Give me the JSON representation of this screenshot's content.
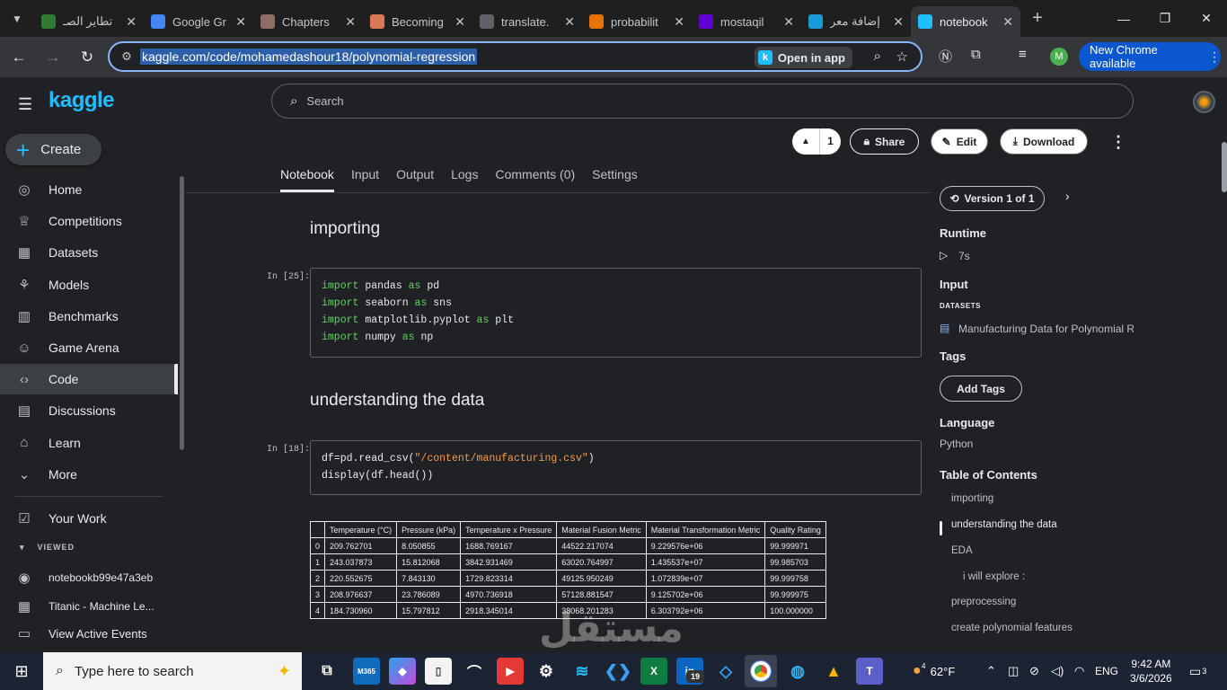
{
  "browser": {
    "tabs": [
      {
        "label": "تطاير الصـ",
        "icon": "globe-green-icon",
        "color": "#2e7d32"
      },
      {
        "label": "Google Gr",
        "icon": "gemini-icon",
        "color": "#4285f4"
      },
      {
        "label": "Chapters",
        "icon": "chapters-icon",
        "color": "#8d6e63"
      },
      {
        "label": "Becoming",
        "icon": "claude-icon",
        "color": "#d97757"
      },
      {
        "label": "translate.",
        "icon": "globe-icon",
        "color": "#5f6368"
      },
      {
        "label": "probabilit",
        "icon": "sheet-icon",
        "color": "#e8710a"
      },
      {
        "label": "mostaqil",
        "icon": "yahoo-icon",
        "color": "#6001d2"
      },
      {
        "label": "إضافة معر",
        "icon": "mostaql-icon",
        "color": "#1d9bd8"
      },
      {
        "label": "notebook",
        "icon": "kaggle-icon",
        "color": "#20beff"
      }
    ],
    "url": "kaggle.com/code/mohamedashour18/polynomial-regression",
    "open_in_app": "Open in app",
    "profile_initial": "M",
    "new_chrome": "New Chrome available"
  },
  "kaggle": {
    "logo": "kaggle",
    "create": "Create",
    "nav": [
      {
        "label": "Home",
        "icon": "compass-icon"
      },
      {
        "label": "Competitions",
        "icon": "trophy-icon"
      },
      {
        "label": "Datasets",
        "icon": "table-icon"
      },
      {
        "label": "Models",
        "icon": "models-icon"
      },
      {
        "label": "Benchmarks",
        "icon": "chart-icon"
      },
      {
        "label": "Game Arena",
        "icon": "robot-icon"
      },
      {
        "label": "Code",
        "icon": "code-icon"
      },
      {
        "label": "Discussions",
        "icon": "discussion-icon"
      },
      {
        "label": "Learn",
        "icon": "learn-icon"
      },
      {
        "label": "More",
        "icon": "chevron-down-icon"
      }
    ],
    "your_work": "Your Work",
    "viewed_label": "VIEWED",
    "viewed": [
      {
        "label": "notebookb99e47a3eb"
      },
      {
        "label": "Titanic - Machine Le..."
      },
      {
        "label": "View Active Events"
      }
    ],
    "search_placeholder": "Search",
    "vote_count": "1",
    "actions": {
      "share": "Share",
      "edit": "Edit",
      "download": "Download"
    },
    "tabs": [
      "Notebook",
      "Input",
      "Output",
      "Logs",
      "Comments (0)",
      "Settings"
    ]
  },
  "notebook": {
    "h_importing": "importing",
    "h_understanding": "understanding the data",
    "cell1_prompt": "In [25]:",
    "cell2_prompt": "In [18]:",
    "imports": [
      {
        "kw": "import",
        "mod": " pandas ",
        "as": "as",
        "alias": " pd"
      },
      {
        "kw": "import",
        "mod": " seaborn ",
        "as": "as",
        "alias": " sns"
      },
      {
        "kw": "import",
        "mod": " matplotlib.pyplot ",
        "as": "as",
        "alias": " plt"
      },
      {
        "kw": "import",
        "mod": " numpy ",
        "as": "as",
        "alias": " np"
      }
    ],
    "read_pre": "df=pd.read_csv(",
    "read_str": "\"/content/manufacturing.csv\"",
    "read_post": ")",
    "display_line": "display(df.head())",
    "table_headers": [
      "",
      "Temperature (°C)",
      "Pressure (kPa)",
      "Temperature x Pressure",
      "Material Fusion Metric",
      "Material Transformation Metric",
      "Quality Rating"
    ],
    "table_rows": [
      [
        "0",
        "209.762701",
        "8.050855",
        "1688.769167",
        "44522.217074",
        "9.229576e+06",
        "99.999971"
      ],
      [
        "1",
        "243.037873",
        "15.812068",
        "3842.931469",
        "63020.764997",
        "1.435537e+07",
        "99.985703"
      ],
      [
        "2",
        "220.552675",
        "7.843130",
        "1729.823314",
        "49125.950249",
        "1.072839e+07",
        "99.999758"
      ],
      [
        "3",
        "208.976637",
        "23.786089",
        "4970.736918",
        "57128.881547",
        "9.125702e+06",
        "99.999975"
      ],
      [
        "4",
        "184.730960",
        "15.797812",
        "2918.345014",
        "38068.201283",
        "6.303792e+06",
        "100.000000"
      ]
    ]
  },
  "panel": {
    "version": "Version 1 of 1",
    "runtime_label": "Runtime",
    "runtime_value": "7s",
    "input_label": "Input",
    "datasets_label": "DATASETS",
    "dataset": "Manufacturing Data for Polynomial Re",
    "tags_label": "Tags",
    "add_tags": "Add Tags",
    "language_label": "Language",
    "language_value": "Python",
    "toc_label": "Table of Contents",
    "toc": [
      "importing",
      "understanding the data",
      "EDA",
      "i will explore :",
      "preprocessing",
      "create polynomial features"
    ]
  },
  "watermark": "مستقل",
  "taskbar": {
    "search_placeholder": "Type here to search",
    "weather": "62°F",
    "lang": "ENG",
    "time": "9:42 AM",
    "date": "3/6/2026",
    "notif_count": "3",
    "weather_badge": "4",
    "teams_badge": "19"
  }
}
